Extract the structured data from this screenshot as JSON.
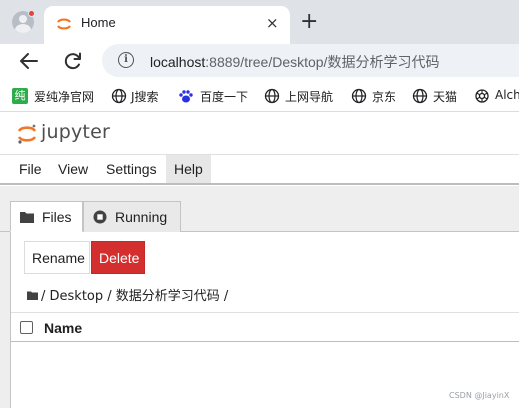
{
  "browser": {
    "tab": {
      "title": "Home",
      "close_glyph": "×"
    },
    "new_tab_glyph": "+",
    "address": {
      "host": "localhost",
      "path": ":8889/tree/Desktop/数据分析学习代码"
    },
    "bookmarks": [
      {
        "label": "爱纯净官网",
        "icon": "green-square-icon",
        "icon_text": "纯"
      },
      {
        "label": "J搜索",
        "icon": "globe-icon"
      },
      {
        "label": "百度一下",
        "icon": "baidu-paw-icon"
      },
      {
        "label": "上网导航",
        "icon": "globe-icon"
      },
      {
        "label": "京东",
        "icon": "globe-icon"
      },
      {
        "label": "天猫",
        "icon": "globe-icon"
      },
      {
        "label": "Alch",
        "icon": "openai-icon"
      }
    ]
  },
  "jupyter": {
    "logo_text": "jupyter",
    "menu": [
      "File",
      "View",
      "Settings",
      "Help"
    ],
    "active_menu": "Help",
    "tabs": [
      {
        "label": "Files",
        "icon": "folder-icon",
        "selected": true
      },
      {
        "label": "Running",
        "icon": "stop-circle-icon",
        "selected": false
      }
    ],
    "buttons": {
      "rename": "Rename",
      "delete": "Delete"
    },
    "breadcrumb": "/ Desktop / 数据分析学习代码 /",
    "list_header": {
      "name_column": "Name"
    }
  },
  "watermark": "CSDN @JiayinX",
  "colors": {
    "delete_button": "#d32f2f",
    "jupyter_orange": "#f37726",
    "tabstrip": "#dfe3e8"
  }
}
